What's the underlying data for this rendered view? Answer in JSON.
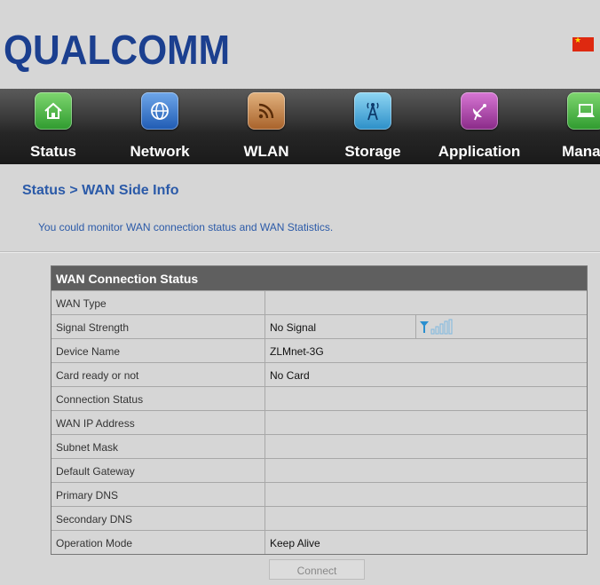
{
  "header": {
    "logo_text": "QUALCOMM",
    "flag": "china-flag",
    "colors": {
      "logo": "#1b3f8f"
    }
  },
  "nav": {
    "items": [
      {
        "label": "Status",
        "icon": "home-icon",
        "color": "#3cae3c"
      },
      {
        "label": "Network",
        "icon": "globe-icon",
        "color": "#2f6fc4"
      },
      {
        "label": "WLAN",
        "icon": "rss-icon",
        "color": "#b8763a"
      },
      {
        "label": "Storage",
        "icon": "antenna-icon",
        "color": "#3aa3d6"
      },
      {
        "label": "Application",
        "icon": "satellite-dish-icon",
        "color": "#a23fa0"
      },
      {
        "label": "Manag",
        "icon": "laptop-icon",
        "color": "#3cae3c"
      }
    ]
  },
  "page": {
    "breadcrumb": "Status > WAN Side Info",
    "description": "You could monitor WAN connection status and WAN Statistics."
  },
  "table": {
    "title": "WAN Connection Status",
    "rows": [
      {
        "label": "WAN Type",
        "value": ""
      },
      {
        "label": "Signal Strength",
        "value": "No Signal",
        "signal_icon": "signal-bars-icon"
      },
      {
        "label": "Device Name",
        "value": "ZLMnet-3G"
      },
      {
        "label": "Card ready or not",
        "value": "No Card"
      },
      {
        "label": "Connection Status",
        "value": ""
      },
      {
        "label": "WAN IP Address",
        "value": ""
      },
      {
        "label": "Subnet Mask",
        "value": ""
      },
      {
        "label": "Default Gateway",
        "value": ""
      },
      {
        "label": "Primary DNS",
        "value": ""
      },
      {
        "label": "Secondary DNS",
        "value": ""
      },
      {
        "label": "Operation Mode",
        "value": "Keep Alive"
      }
    ]
  },
  "actions": {
    "connect_label": "Connect"
  }
}
